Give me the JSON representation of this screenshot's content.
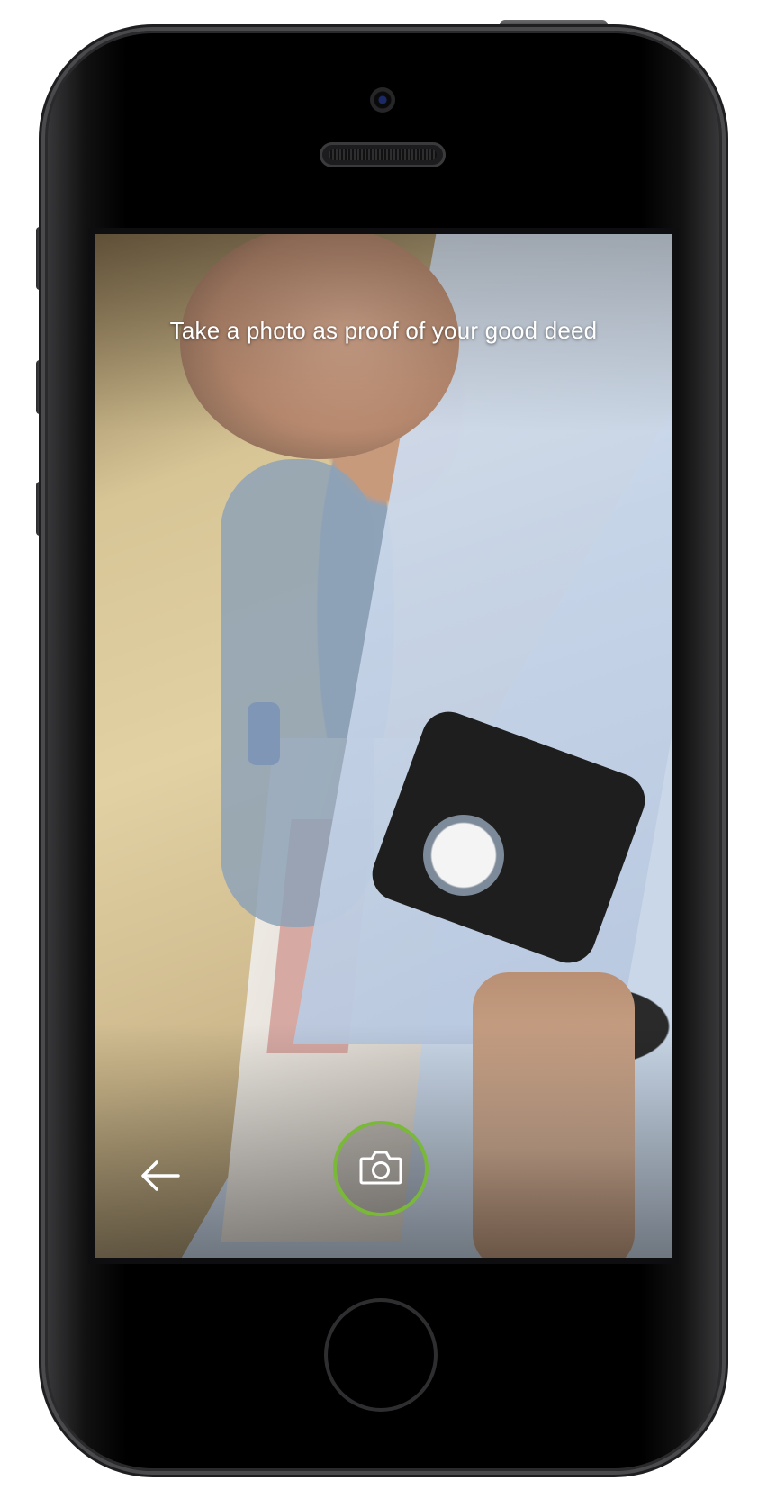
{
  "screen": {
    "prompt": "Take a photo as proof of your good deed"
  },
  "controls": {
    "back_icon": "arrow-left-icon",
    "shutter_icon": "camera-icon",
    "shutter_ring_color": "#7ab83a",
    "icon_color": "#ffffff"
  }
}
